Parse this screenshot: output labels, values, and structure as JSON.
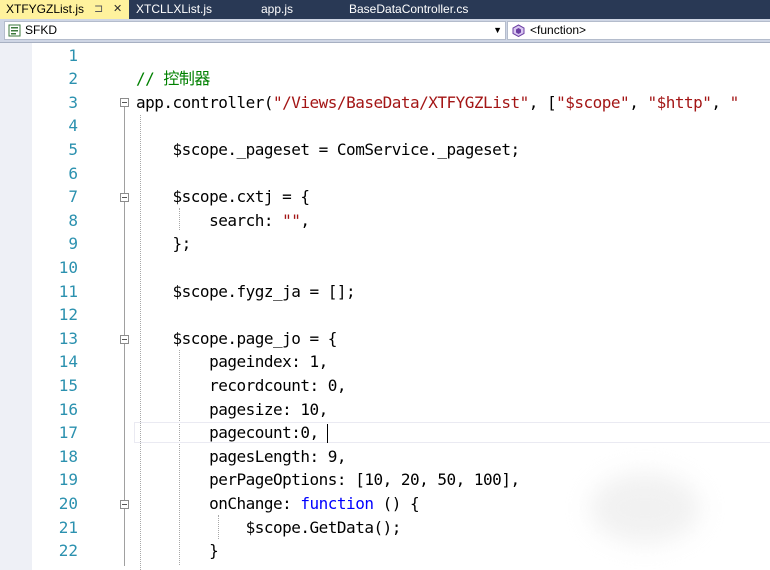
{
  "tabs": [
    {
      "label": "XTFYGZList.js",
      "active": true,
      "pin": "⊐",
      "close": "✕"
    },
    {
      "label": "XTCLLXList.js",
      "active": false
    },
    {
      "label": "app.js",
      "active": false
    },
    {
      "label": "BaseDataController.cs",
      "active": false
    }
  ],
  "navbar": {
    "left_value": "SFKD",
    "right_value": "<function>",
    "left_icon": "file-icon",
    "right_icon": "function-icon"
  },
  "editor": {
    "line_numbers": [
      "1",
      "2",
      "3",
      "4",
      "5",
      "6",
      "7",
      "8",
      "9",
      "10",
      "11",
      "12",
      "13",
      "14",
      "15",
      "16",
      "17",
      "18",
      "19",
      "20",
      "21",
      "22"
    ],
    "lines": [
      "",
      "// 控制器",
      "app.controller(\"/Views/BaseData/XTFYGZList\", [\"$scope\", \"$http\", \"",
      "",
      "    $scope._pageset = ComService._pageset;",
      "",
      "    $scope.cxtj = {",
      "        search: \"\",",
      "    };",
      "",
      "    $scope.fygz_ja = [];",
      "",
      "    $scope.page_jo = {",
      "        pageindex: 1,",
      "        recordcount: 0,",
      "        pagesize: 10,",
      "        pagecount:0,",
      "        pagesLength: 9,",
      "        perPageOptions: [10, 20, 50, 100],",
      "        onChange: function () {",
      "            $scope.GetData();",
      "        }"
    ],
    "current_line": 17
  },
  "colors": {
    "tab_strip": "#293955",
    "active_tab": "#fff29d",
    "line_number": "#2b91af",
    "string": "#a31515",
    "comment": "#008000",
    "keyword": "#0000ff"
  }
}
